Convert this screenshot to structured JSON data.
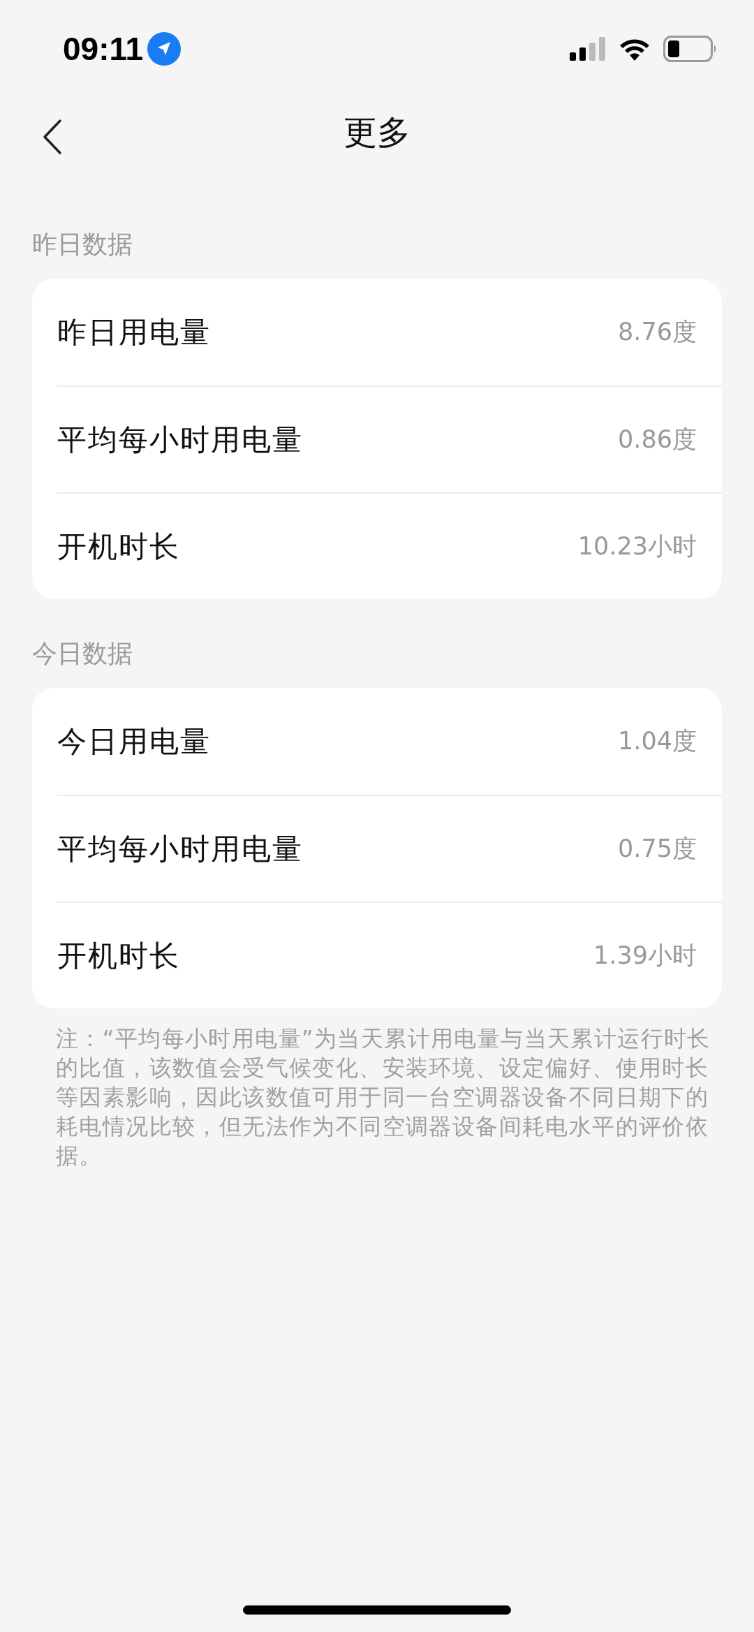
{
  "status_bar": {
    "time": "09:11"
  },
  "header": {
    "title": "更多"
  },
  "sections": [
    {
      "title": "昨日数据",
      "rows": [
        {
          "label": "昨日用电量",
          "value": "8.76度"
        },
        {
          "label": "平均每小时用电量",
          "value": "0.86度"
        },
        {
          "label": "开机时长",
          "value": "10.23小时"
        }
      ]
    },
    {
      "title": "今日数据",
      "rows": [
        {
          "label": "今日用电量",
          "value": "1.04度"
        },
        {
          "label": "平均每小时用电量",
          "value": "0.75度"
        },
        {
          "label": "开机时长",
          "value": "1.39小时"
        }
      ]
    }
  ],
  "note": "注：“平均每小时用电量”为当天累计用电量与当天累计运行时长的比值，该数值会受气候变化、安装环境、设定偏好、使用时长等因素影响，因此该数值可用于同一台空调器设备不同日期下的耗电情况比较，但无法作为不同空调器设备间耗电水平的评价依据。"
}
